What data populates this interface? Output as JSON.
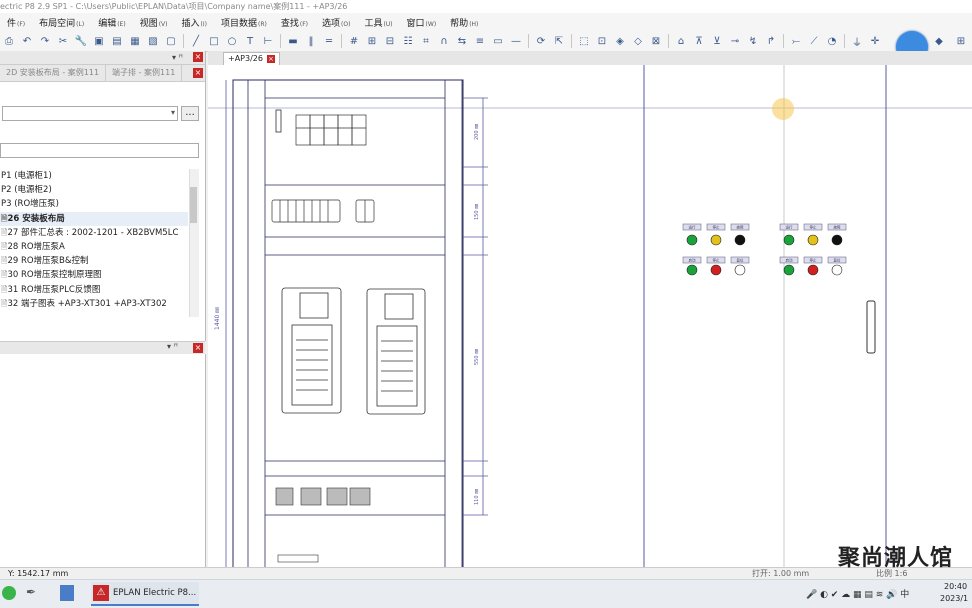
{
  "title": "ectric P8 2.9 SP1 - C:\\Users\\Public\\EPLAN\\Data\\项目\\Company name\\案例111 - +AP3/26",
  "menu": [
    {
      "label": "件",
      "key": "(F)"
    },
    {
      "label": "布局空间",
      "key": "(L)"
    },
    {
      "label": "编辑",
      "key": "(E)"
    },
    {
      "label": "视图",
      "key": "(V)"
    },
    {
      "label": "插入",
      "key": "(I)"
    },
    {
      "label": "项目数据",
      "key": "(R)"
    },
    {
      "label": "查找",
      "key": "(F)"
    },
    {
      "label": "选项",
      "key": "(O)"
    },
    {
      "label": "工具",
      "key": "(U)"
    },
    {
      "label": "窗口",
      "key": "(W)"
    },
    {
      "label": "帮助",
      "key": "(H)"
    }
  ],
  "panel": {
    "tabs": [
      "2D 安装板布局 - 案例111",
      "端子排 - 案例111"
    ],
    "close": "×",
    "filter_button": "...",
    "pages": [
      {
        "label": "P1 (电源柜1)"
      },
      {
        "label": "P2 (电源柜2)"
      },
      {
        "label": "P3 (RO增压泵)"
      },
      {
        "label": "26 安装板布局",
        "selected": true
      },
      {
        "label": "27 部件汇总表 : 2002-1201 - XB2BVM5LC"
      },
      {
        "label": "28 RO增压泵A"
      },
      {
        "label": "29 RO增压泵B&控制"
      },
      {
        "label": "30 RO增压泵控制原理图"
      },
      {
        "label": "31 RO增压泵PLC反馈图"
      },
      {
        "label": "32 端子图表 +AP3-XT301 +AP3-XT302"
      }
    ],
    "second_panel_pin": "▾ ꟸ ×"
  },
  "document_tab": "+AP3/26",
  "drawing": {
    "dims": [
      "1440 ㎜",
      "200 ㎜",
      "150 ㎜",
      "550 ㎜",
      "110 ㎜"
    ],
    "lamp_labels": [
      "运行",
      "停止",
      "故障",
      "运行",
      "停止",
      "故障"
    ],
    "button_labels": [
      "启动",
      "停止",
      "复位",
      "启动",
      "停止",
      "复位"
    ]
  },
  "status": {
    "coord": "Y: 1542.17 mm",
    "grid": "打开: 1.00 mm",
    "scale": "比例 1:6"
  },
  "taskbar": {
    "app": "EPLAN Electric P8...",
    "time": "20:40",
    "date": "2023/1"
  },
  "watermark": "聚尚潮人馆",
  "colors": {
    "accent": "#3d8be0",
    "close": "#c62828",
    "green": "#1aa33a",
    "red": "#d02020",
    "yellow": "#e2c21a"
  }
}
